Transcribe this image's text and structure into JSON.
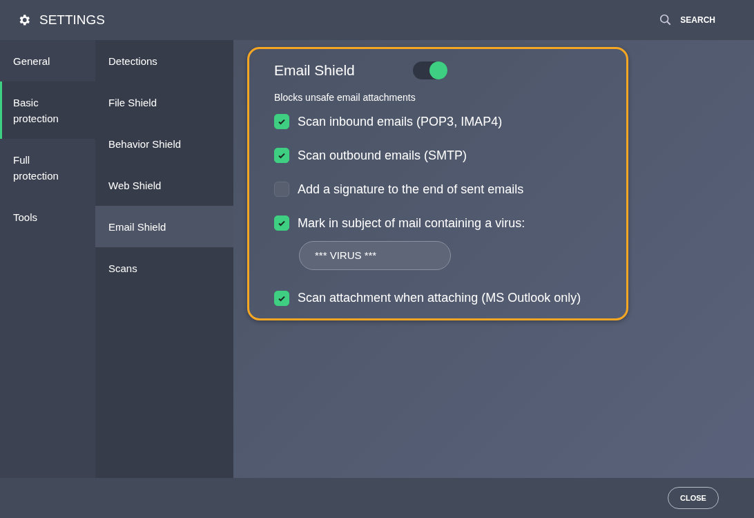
{
  "header": {
    "title": "SETTINGS",
    "search": "SEARCH"
  },
  "categories": [
    {
      "label": "General",
      "selected": false
    },
    {
      "label": "Basic protection",
      "selected": true
    },
    {
      "label": "Full protection",
      "selected": false
    },
    {
      "label": "Tools",
      "selected": false
    }
  ],
  "subcategories": [
    {
      "label": "Detections",
      "selected": false
    },
    {
      "label": "File Shield",
      "selected": false
    },
    {
      "label": "Behavior Shield",
      "selected": false
    },
    {
      "label": "Web Shield",
      "selected": false
    },
    {
      "label": "Email Shield",
      "selected": true
    },
    {
      "label": "Scans",
      "selected": false
    }
  ],
  "panel": {
    "title": "Email Shield",
    "on": true,
    "description": "Blocks unsafe email attachments",
    "highlighted": true,
    "options": [
      {
        "label": "Scan inbound emails (POP3, IMAP4)",
        "checked": true
      },
      {
        "label": "Scan outbound emails (SMTP)",
        "checked": true
      },
      {
        "label": "Add a signature to the end of sent emails",
        "checked": false
      },
      {
        "label": "Mark in subject of mail containing a virus:",
        "checked": true,
        "value": "*** VIRUS ***"
      },
      {
        "label": "Scan attachment when attaching (MS Outlook only)",
        "checked": true
      }
    ]
  },
  "footer": {
    "close": "CLOSE"
  }
}
